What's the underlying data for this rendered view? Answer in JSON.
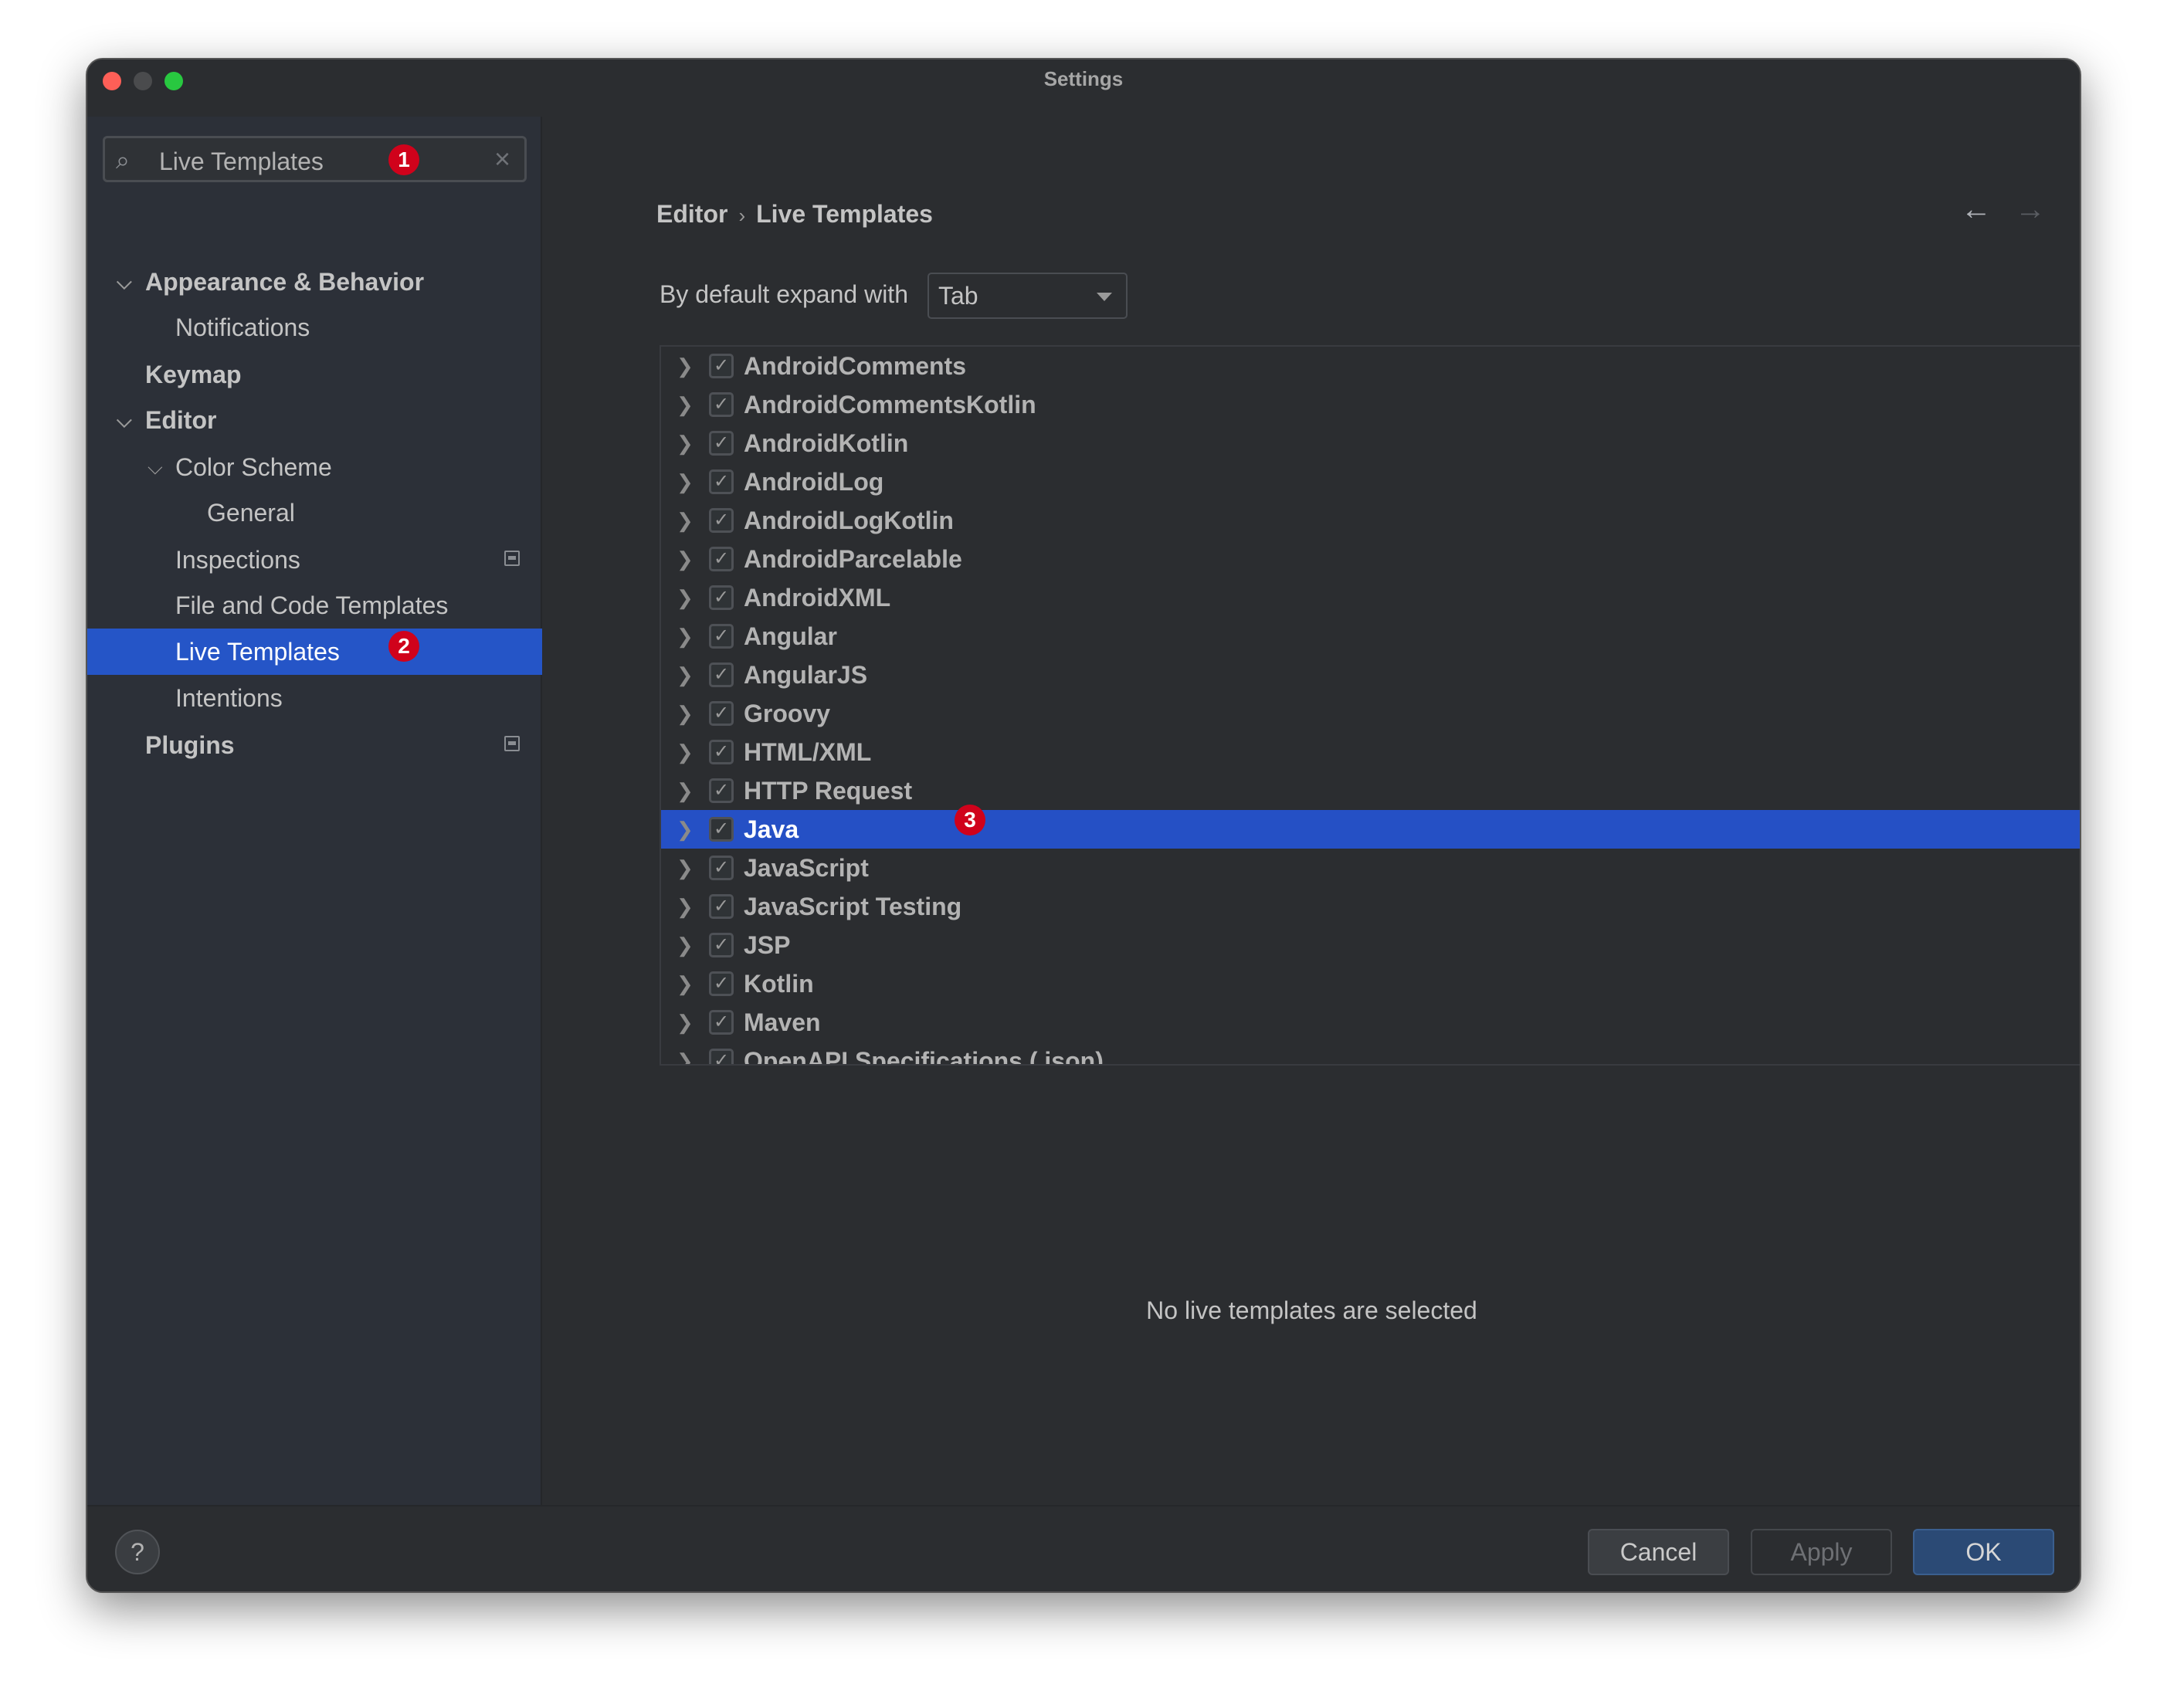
{
  "window": {
    "title": "Settings"
  },
  "search": {
    "value": "Live Templates"
  },
  "badges": [
    "1",
    "2",
    "3"
  ],
  "sidebar": {
    "items": [
      {
        "label": "Appearance & Behavior"
      },
      {
        "label": "Notifications"
      },
      {
        "label": "Keymap"
      },
      {
        "label": "Editor"
      },
      {
        "label": "Color Scheme"
      },
      {
        "label": "General"
      },
      {
        "label": "Inspections"
      },
      {
        "label": "File and Code Templates"
      },
      {
        "label": "Live Templates",
        "selected": true
      },
      {
        "label": "Intentions"
      },
      {
        "label": "Plugins"
      }
    ]
  },
  "breadcrumb": {
    "parent": "Editor",
    "separator": "›",
    "current": "Live Templates"
  },
  "expand": {
    "label": "By default expand with",
    "value": "Tab"
  },
  "templates": [
    {
      "label": "AndroidComments",
      "checked": true
    },
    {
      "label": "AndroidCommentsKotlin",
      "checked": true
    },
    {
      "label": "AndroidKotlin",
      "checked": true
    },
    {
      "label": "AndroidLog",
      "checked": true
    },
    {
      "label": "AndroidLogKotlin",
      "checked": true
    },
    {
      "label": "AndroidParcelable",
      "checked": true
    },
    {
      "label": "AndroidXML",
      "checked": true
    },
    {
      "label": "Angular",
      "checked": true
    },
    {
      "label": "AngularJS",
      "checked": true
    },
    {
      "label": "Groovy",
      "checked": true
    },
    {
      "label": "HTML/XML",
      "checked": true
    },
    {
      "label": "HTTP Request",
      "checked": true
    },
    {
      "label": "Java",
      "checked": true,
      "selected": true
    },
    {
      "label": "JavaScript",
      "checked": true
    },
    {
      "label": "JavaScript Testing",
      "checked": true
    },
    {
      "label": "JSP",
      "checked": true
    },
    {
      "label": "Kotlin",
      "checked": true
    },
    {
      "label": "Maven",
      "checked": true
    },
    {
      "label": "OpenAPI Specifications (.json)",
      "checked": true
    }
  ],
  "empty_message": "No live templates are selected",
  "buttons": {
    "help": "?",
    "cancel": "Cancel",
    "apply": "Apply",
    "ok": "OK"
  },
  "colors": {
    "accent": "#2555c7",
    "badge": "#d0021b",
    "ok": "#2b4a75"
  }
}
